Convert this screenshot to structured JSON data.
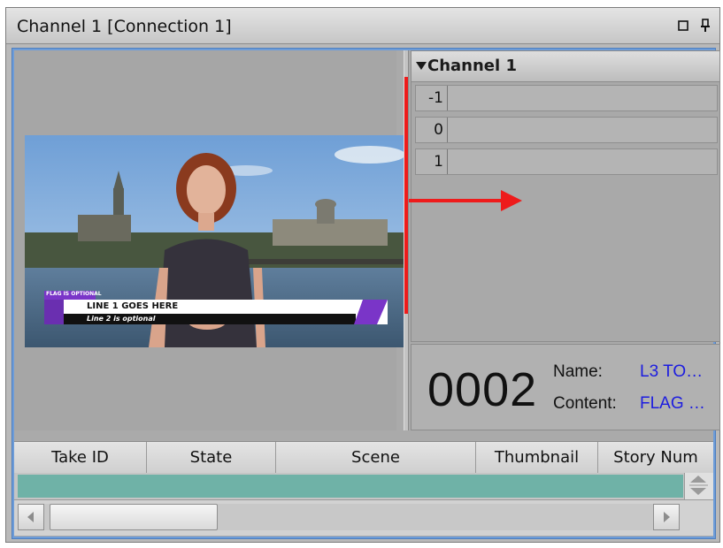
{
  "window": {
    "title": "Channel 1 [Connection 1]",
    "icons": [
      "restore-icon",
      "pin-icon"
    ]
  },
  "preview": {
    "lower_third": {
      "flag": "FLAG IS OPTIONAL",
      "line1": "LINE 1 GOES HERE",
      "line2": "Line 2 is optional"
    }
  },
  "channel": {
    "header": "Channel 1",
    "rows": [
      {
        "index": "-1"
      },
      {
        "index": "0"
      },
      {
        "index": "1"
      }
    ]
  },
  "info": {
    "take_number": "0002",
    "name_label": "Name:",
    "name_value": "L3 TO…",
    "content_label": "Content:",
    "content_value": "FLAG …"
  },
  "table": {
    "columns": [
      "Take ID",
      "State",
      "Scene",
      "Thumbnail",
      "Story Num"
    ]
  },
  "colors": {
    "accent_blue": "#6d9cd8",
    "link_blue": "#1c1ce0",
    "annotation_red": "#ee1b1b",
    "row_teal": "#6fb2a7"
  }
}
